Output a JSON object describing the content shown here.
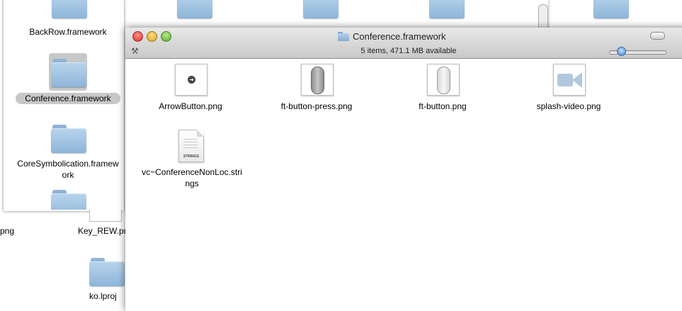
{
  "background": {
    "top_folders": [
      {
        "name": "folder-bg-1"
      },
      {
        "name": "folder-bg-2"
      },
      {
        "name": "folder-bg-3"
      },
      {
        "name": "folder-bg-4"
      },
      {
        "name": "folder-bg-5"
      }
    ],
    "left_window": {
      "items": [
        {
          "label": "BackRow.framework"
        },
        {
          "label": "Conference.framework",
          "selected": true
        },
        {
          "label": "CoreSymbolication.framew",
          "label2": "ork"
        }
      ]
    },
    "desktop_labels": {
      "png_fragment": "png",
      "key_rew": "Key_REW.pn",
      "lproj": "ko.lproj"
    }
  },
  "window": {
    "title": "Conference.framework",
    "status": "5 items, 471.1 MB available",
    "icon_size_slider": {
      "value": 0.17
    },
    "items": [
      {
        "label": "ArrowButton.png",
        "icon": "arrow-button-thumbnail"
      },
      {
        "label": "ft-button-press.png",
        "icon": "dark-capsule-thumbnail"
      },
      {
        "label": "ft-button.png",
        "icon": "light-capsule-thumbnail"
      },
      {
        "label": "splash-video.png",
        "icon": "video-camera-thumbnail"
      },
      {
        "label": "vc~ConferenceNonLoc.stri",
        "label2": "ngs",
        "icon": "strings-file-icon",
        "badge": "STRINGS"
      }
    ]
  },
  "colors": {
    "folder": "#8db5d9",
    "selection": "#c8c8c8",
    "close": "#d52f2a",
    "minimize": "#d6a01a",
    "zoom": "#58a82a"
  }
}
